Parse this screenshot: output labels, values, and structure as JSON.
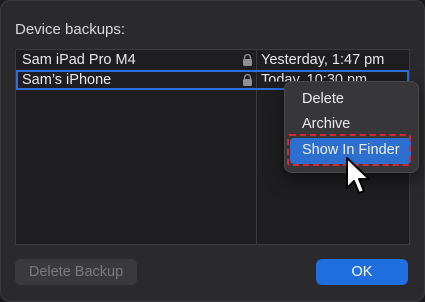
{
  "dialog": {
    "title": "Device backups:"
  },
  "backups": [
    {
      "name": "Sam iPad Pro M4",
      "date": "Yesterday, 1:47 pm",
      "locked": true,
      "selected": false
    },
    {
      "name": "Sam’s iPhone",
      "date": "Today, 10:30 pm",
      "locked": true,
      "selected": true
    }
  ],
  "context_menu": {
    "items": [
      {
        "label": "Delete"
      },
      {
        "label": "Archive"
      },
      {
        "label": "Show In Finder",
        "highlighted": true
      }
    ]
  },
  "buttons": {
    "delete_backup": "Delete Backup",
    "ok": "OK"
  },
  "colors": {
    "accent": "#1f6fe0",
    "annotation": "#e0242b"
  }
}
